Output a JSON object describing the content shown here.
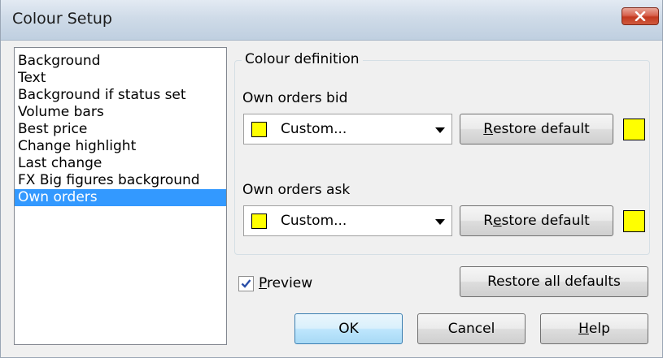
{
  "window": {
    "title": "Colour Setup"
  },
  "list": {
    "items": [
      {
        "label": "Background",
        "selected": false
      },
      {
        "label": "Text",
        "selected": false
      },
      {
        "label": "Background if status set",
        "selected": false
      },
      {
        "label": "Volume bars",
        "selected": false
      },
      {
        "label": "Best price",
        "selected": false
      },
      {
        "label": "Change highlight",
        "selected": false
      },
      {
        "label": "Last change",
        "selected": false
      },
      {
        "label": "FX Big figures background",
        "selected": false
      },
      {
        "label": "Own orders",
        "selected": true
      }
    ]
  },
  "colour_definition": {
    "legend": "Colour definition",
    "bid": {
      "label": "Own orders bid",
      "value": "Custom...",
      "swatch_color": "#ffff00",
      "restore_pre": "",
      "restore_ul": "R",
      "restore_post": "estore default"
    },
    "ask": {
      "label": "Own orders ask",
      "value": "Custom...",
      "swatch_color": "#ffff00",
      "restore_pre": "R",
      "restore_ul": "e",
      "restore_post": "store default"
    }
  },
  "preview": {
    "checked": true,
    "label_ul": "P",
    "label_rest": "review"
  },
  "buttons": {
    "restore_all": "Restore all defaults",
    "ok": "OK",
    "cancel": "Cancel",
    "help_ul": "H",
    "help_rest": "elp"
  },
  "colors": {
    "selection": "#3399ff",
    "swatch": "#ffff00"
  }
}
